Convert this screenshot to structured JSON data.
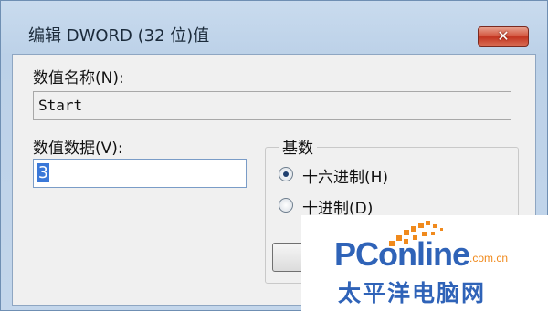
{
  "window": {
    "title": "编辑 DWORD (32 位)值"
  },
  "close_button": {
    "glyph": "✕"
  },
  "value_name": {
    "label": "数值名称(N):",
    "value": "Start"
  },
  "value_data": {
    "label": "数值数据(V):",
    "value": "3"
  },
  "base_group": {
    "legend": "基数",
    "options": [
      {
        "label": "十六进制(H)",
        "selected": true
      },
      {
        "label": "十进制(D)",
        "selected": false
      }
    ]
  },
  "watermark": {
    "brand_main": "PConline",
    "brand_domain": ".com.cn",
    "brand_cn": "太平洋电脑网"
  },
  "colors": {
    "accent_blue": "#2f63b8",
    "accent_orange": "#f08a1d",
    "selection": "#3a78d8"
  }
}
